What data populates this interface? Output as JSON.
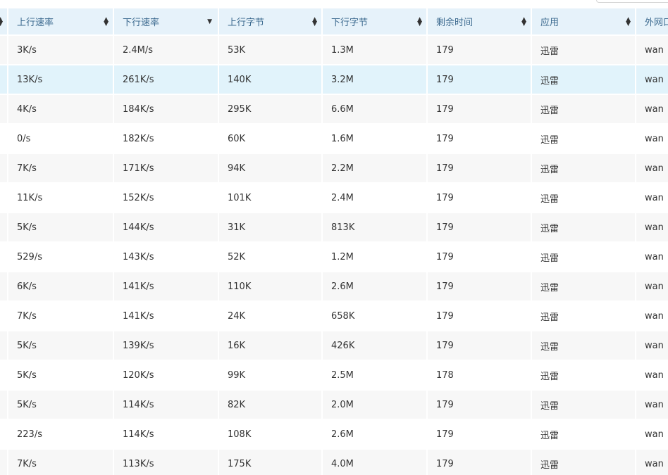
{
  "table": {
    "columns": [
      {
        "label": "上行速率",
        "sort": "both"
      },
      {
        "label": "下行速率",
        "sort": "desc"
      },
      {
        "label": "上行字节",
        "sort": "both"
      },
      {
        "label": "下行字节",
        "sort": "both"
      },
      {
        "label": "剩余时间",
        "sort": "both"
      },
      {
        "label": "应用",
        "sort": "both"
      },
      {
        "label": "外网口",
        "sort": "none"
      }
    ],
    "selected_row": 1,
    "rows": [
      [
        "3K/s",
        "2.4M/s",
        "53K",
        "1.3M",
        "179",
        "迅雷",
        "wan"
      ],
      [
        "13K/s",
        "261K/s",
        "140K",
        "3.2M",
        "179",
        "迅雷",
        "wan"
      ],
      [
        "4K/s",
        "184K/s",
        "295K",
        "6.6M",
        "179",
        "迅雷",
        "wan"
      ],
      [
        "0/s",
        "182K/s",
        "60K",
        "1.6M",
        "179",
        "迅雷",
        "wan"
      ],
      [
        "7K/s",
        "171K/s",
        "94K",
        "2.2M",
        "179",
        "迅雷",
        "wan"
      ],
      [
        "11K/s",
        "152K/s",
        "101K",
        "2.4M",
        "179",
        "迅雷",
        "wan"
      ],
      [
        "5K/s",
        "144K/s",
        "31K",
        "813K",
        "179",
        "迅雷",
        "wan"
      ],
      [
        "529/s",
        "143K/s",
        "52K",
        "1.2M",
        "179",
        "迅雷",
        "wan"
      ],
      [
        "6K/s",
        "141K/s",
        "110K",
        "2.6M",
        "179",
        "迅雷",
        "wan"
      ],
      [
        "7K/s",
        "141K/s",
        "24K",
        "658K",
        "179",
        "迅雷",
        "wan"
      ],
      [
        "5K/s",
        "139K/s",
        "16K",
        "426K",
        "179",
        "迅雷",
        "wan"
      ],
      [
        "5K/s",
        "120K/s",
        "99K",
        "2.5M",
        "178",
        "迅雷",
        "wan"
      ],
      [
        "5K/s",
        "114K/s",
        "82K",
        "2.0M",
        "179",
        "迅雷",
        "wan"
      ],
      [
        "223/s",
        "114K/s",
        "108K",
        "2.6M",
        "179",
        "迅雷",
        "wan"
      ],
      [
        "7K/s",
        "113K/s",
        "175K",
        "4.0M",
        "179",
        "迅雷",
        "wan"
      ]
    ]
  },
  "icons": {
    "sort_both": "sort-up-down-icon",
    "sort_desc": "caret-down-icon"
  },
  "colors": {
    "header_bg": "#e6f2fa",
    "header_text": "#3c6a8f",
    "row_alt": "#f7f7f7",
    "row_selected": "#e1f3fb"
  }
}
